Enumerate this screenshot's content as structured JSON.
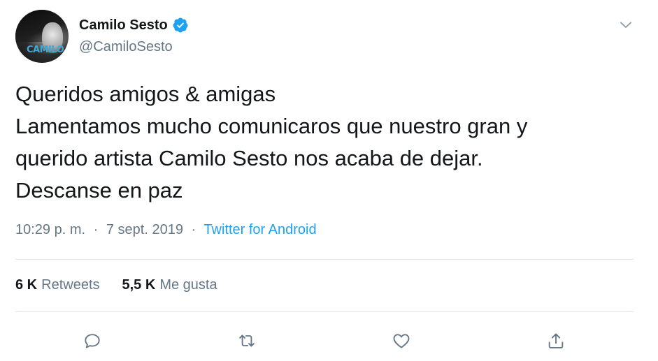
{
  "user": {
    "display_name": "Camilo Sesto",
    "handle": "@CamiloSesto",
    "avatar_logo": "CAMILO",
    "verified": true
  },
  "tweet": {
    "lines": [
      "Queridos amigos & amigas",
      "Lamentamos mucho comunicaros que nuestro gran y",
      "querido artista Camilo Sesto nos acaba de dejar.",
      "Descanse en paz"
    ],
    "time": "10:29 p. m.",
    "date": "7 sept. 2019",
    "separator": "·",
    "source": "Twitter for Android"
  },
  "stats": {
    "retweets_count": "6 K",
    "retweets_label": "Retweets",
    "likes_count": "5,5 K",
    "likes_label": "Me gusta"
  },
  "icons": {
    "menu": "chevron-down-icon",
    "verified": "verified-badge-icon",
    "reply": "reply-icon",
    "retweet": "retweet-icon",
    "like": "heart-icon",
    "share": "share-icon"
  },
  "colors": {
    "accent": "#1da1f2",
    "text": "#14171a",
    "muted": "#657786",
    "divider": "#e1e8ed"
  }
}
